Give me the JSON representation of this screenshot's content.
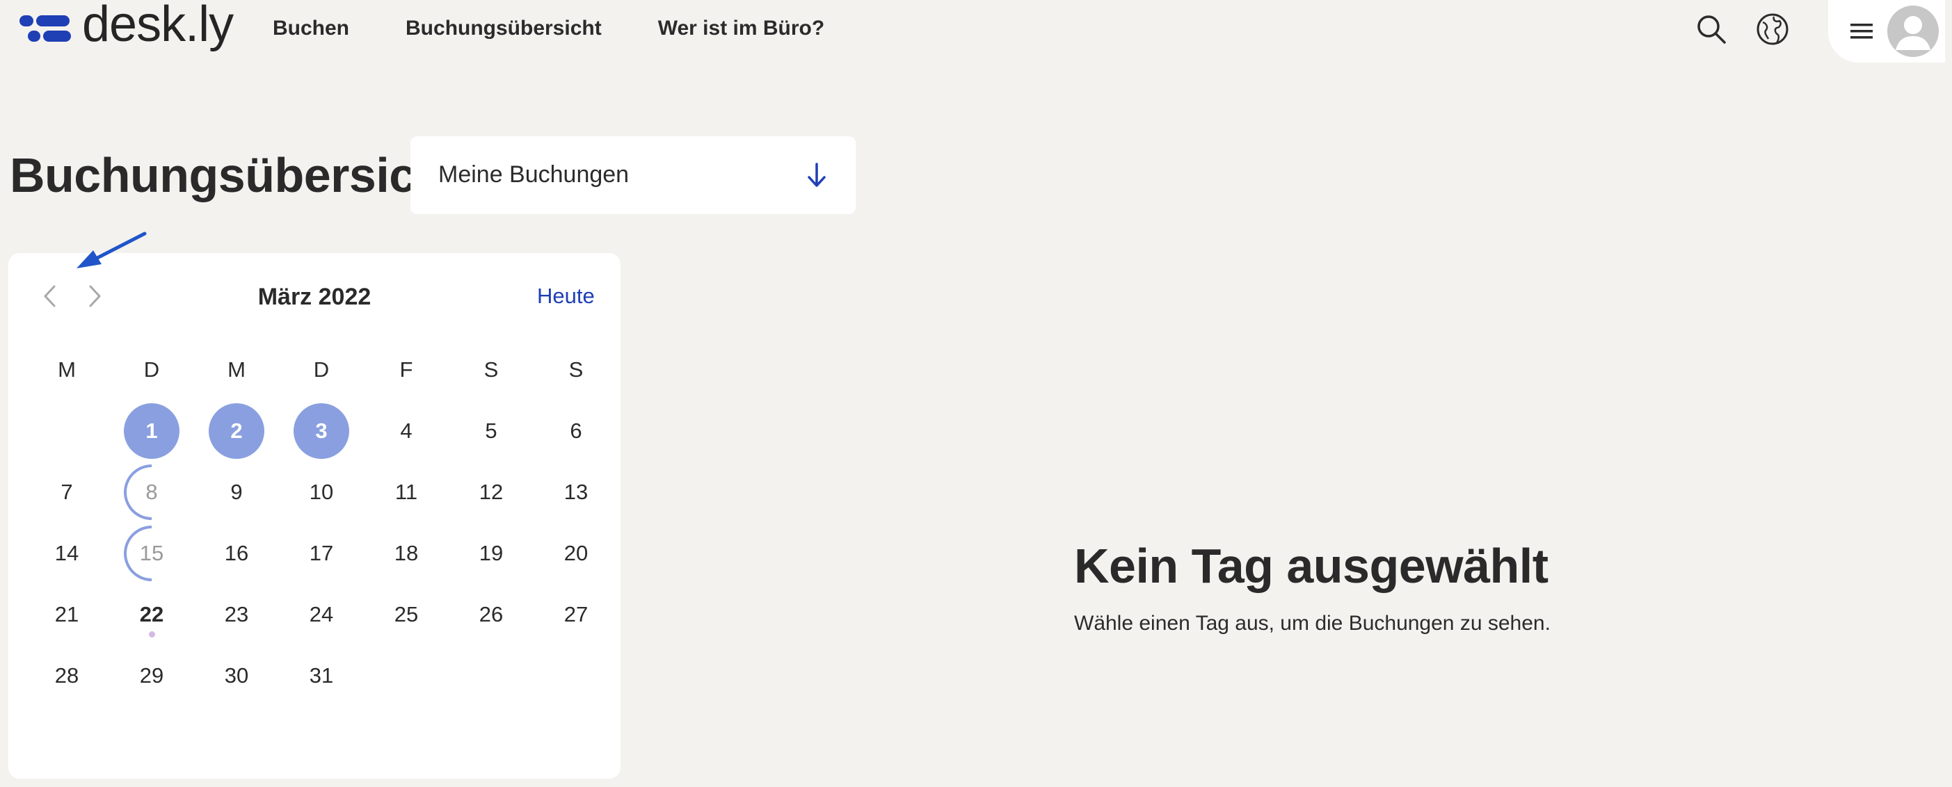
{
  "brand": {
    "name": "desk.ly",
    "color": "#1f3fb5"
  },
  "nav": {
    "items": [
      {
        "label": "Buchen"
      },
      {
        "label": "Buchungsübersicht"
      },
      {
        "label": "Wer ist im Büro?"
      }
    ]
  },
  "header_icons": [
    "search-icon",
    "globe-icon",
    "hamburger-menu-icon",
    "user-avatar-icon"
  ],
  "page": {
    "title": "Buchungsübersicht",
    "filter_select": {
      "value": "Meine Buchungen",
      "icon": "arrow-down-icon"
    }
  },
  "calendar": {
    "month_label": "März 2022",
    "today_button": "Heute",
    "weekdays": [
      "M",
      "D",
      "M",
      "D",
      "F",
      "S",
      "S"
    ],
    "days": [
      {
        "n": "1",
        "state": "booked"
      },
      {
        "n": "2",
        "state": "booked"
      },
      {
        "n": "3",
        "state": "booked"
      },
      {
        "n": "4"
      },
      {
        "n": "5"
      },
      {
        "n": "6"
      },
      {
        "n": "7"
      },
      {
        "n": "8",
        "state": "partial"
      },
      {
        "n": "9"
      },
      {
        "n": "10"
      },
      {
        "n": "11"
      },
      {
        "n": "12"
      },
      {
        "n": "13"
      },
      {
        "n": "14"
      },
      {
        "n": "15",
        "state": "partial"
      },
      {
        "n": "16"
      },
      {
        "n": "17"
      },
      {
        "n": "18"
      },
      {
        "n": "19"
      },
      {
        "n": "20"
      },
      {
        "n": "21"
      },
      {
        "n": "22",
        "state": "today"
      },
      {
        "n": "23"
      },
      {
        "n": "24"
      },
      {
        "n": "25"
      },
      {
        "n": "26"
      },
      {
        "n": "27"
      },
      {
        "n": "28"
      },
      {
        "n": "29"
      },
      {
        "n": "30"
      },
      {
        "n": "31"
      }
    ],
    "first_weekday_offset": 1,
    "colors": {
      "booked": "#8a9fe0",
      "today_dot": "#d6b8e6",
      "accent": "#1f3fb5"
    }
  },
  "empty_state": {
    "title": "Kein Tag ausgewählt",
    "text": "Wähle einen Tag aus, um die Buchungen zu sehen."
  }
}
